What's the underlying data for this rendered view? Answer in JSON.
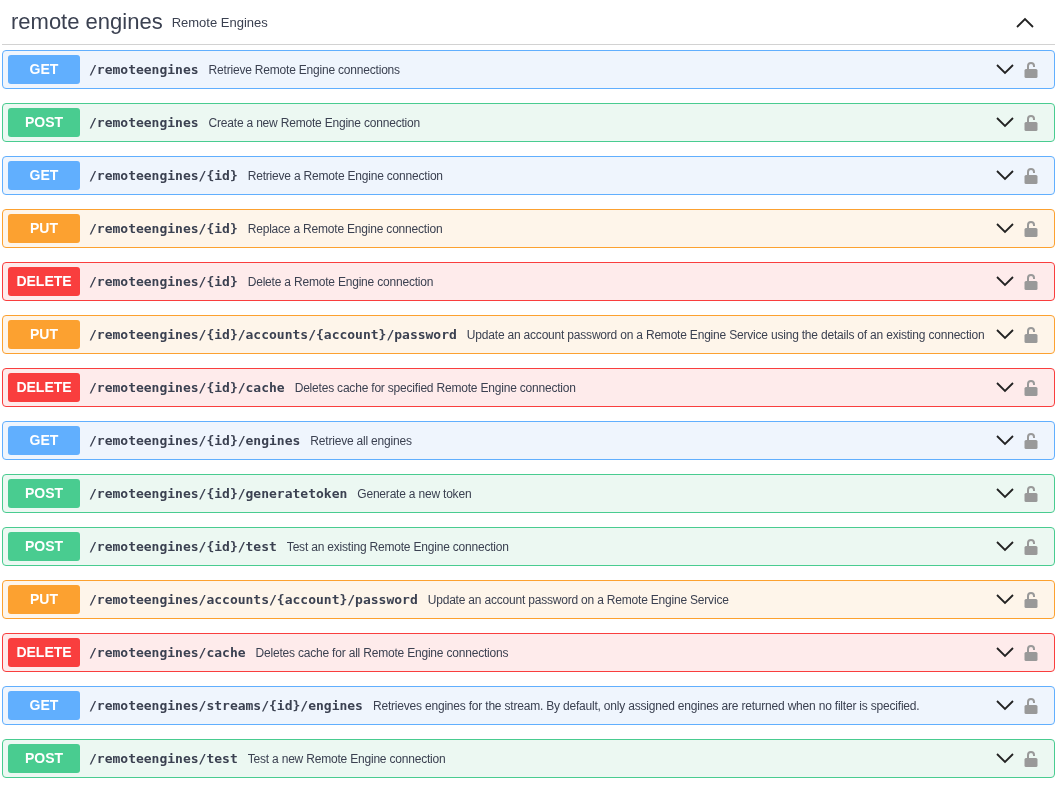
{
  "section": {
    "title": "remote engines",
    "description": "Remote Engines",
    "expanded": true
  },
  "operations": [
    {
      "method": "GET",
      "path": "/remoteengines",
      "summary": "Retrieve Remote Engine connections",
      "expanded": false
    },
    {
      "method": "POST",
      "path": "/remoteengines",
      "summary": "Create a new Remote Engine connection",
      "expanded": false
    },
    {
      "method": "GET",
      "path": "/remoteengines/{id}",
      "summary": "Retrieve a Remote Engine connection",
      "expanded": false
    },
    {
      "method": "PUT",
      "path": "/remoteengines/{id}",
      "summary": "Replace a Remote Engine connection",
      "expanded": false
    },
    {
      "method": "DELETE",
      "path": "/remoteengines/{id}",
      "summary": "Delete a Remote Engine connection",
      "expanded": false
    },
    {
      "method": "PUT",
      "path": "/remoteengines/{id}/accounts/{account}/password",
      "summary": "Update an account password on a Remote Engine Service using the details of an existing connection",
      "expanded": false
    },
    {
      "method": "DELETE",
      "path": "/remoteengines/{id}/cache",
      "summary": "Deletes cache for specified Remote Engine connection",
      "expanded": false
    },
    {
      "method": "GET",
      "path": "/remoteengines/{id}/engines",
      "summary": "Retrieve all engines",
      "expanded": false
    },
    {
      "method": "POST",
      "path": "/remoteengines/{id}/generatetoken",
      "summary": "Generate a new token",
      "expanded": false
    },
    {
      "method": "POST",
      "path": "/remoteengines/{id}/test",
      "summary": "Test an existing Remote Engine connection",
      "expanded": false
    },
    {
      "method": "PUT",
      "path": "/remoteengines/accounts/{account}/password",
      "summary": "Update an account password on a Remote Engine Service",
      "expanded": false
    },
    {
      "method": "DELETE",
      "path": "/remoteengines/cache",
      "summary": "Deletes cache for all Remote Engine connections",
      "expanded": false
    },
    {
      "method": "GET",
      "path": "/remoteengines/streams/{id}/engines",
      "summary": "Retrieves engines for the stream. By default, only assigned engines are returned when no filter is specified.",
      "expanded": false
    },
    {
      "method": "POST",
      "path": "/remoteengines/test",
      "summary": "Test a new Remote Engine connection",
      "expanded": false
    }
  ]
}
